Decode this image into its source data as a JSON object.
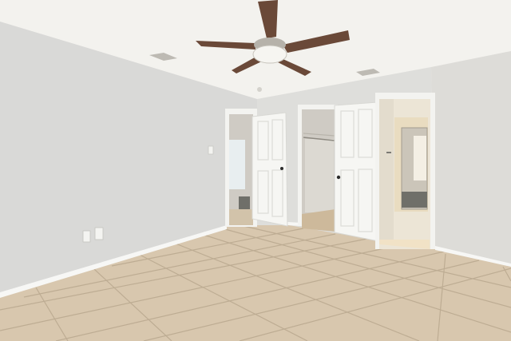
{
  "scene": {
    "description_visible_text": "",
    "colors": {
      "ceiling": "#f3f2ee",
      "left_wall": "#d9d9d7",
      "back_wall": "#dededb",
      "right_wall": "#dddcd8",
      "floor_tile": "#d8c7ae",
      "grout": "#b5a48a",
      "baseboard": "#f7f7f5",
      "door": "#f6f6f3",
      "door_frame": "#f3f3f0",
      "fan_blade": "#6a4938",
      "fan_housing": "#b6b2aa",
      "closet_interior": "#cfcbc4",
      "bath_floor": "#f1e2c6",
      "dark_opening": "#6f6f69"
    },
    "icons": {
      "ceiling_fan": "ceiling-fan-icon",
      "light_switch": "light-switch-icon",
      "outlet": "outlet-icon",
      "vent": "vent-icon",
      "door_knob": "door-knob-icon"
    }
  }
}
